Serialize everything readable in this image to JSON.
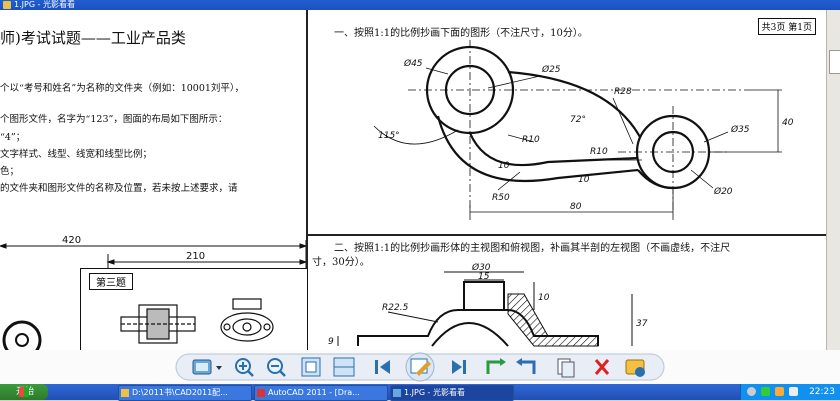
{
  "window": {
    "title": "1.JPG - 光影看看"
  },
  "document": {
    "left": {
      "title": "师)考试试题——工业产品类",
      "lines": [
        "个以“考号和姓名”为名称的文件夹（例如：10001刘平），",
        "个图形文件，名字为“123”，图面的布局如下图所示：",
        "“4”；",
        "文字样式、线型、线宽和线型比例；",
        "色；",
        "的文件夹和图形文件的名称及位置，若未按上述要求，请"
      ],
      "dim_420": "420",
      "dim_210": "210",
      "box_label": "第三题"
    },
    "page_box": "共3页  第1页",
    "q1": "一、按照1:1的比例抄画下面的图形（不注尺寸，10分）。",
    "q2_line1": "二、按照1:1的比例抄画形体的主视图和俯视图，补画其半剖的左视图（不画虚线，不注尺",
    "q2_line2": "寸，30分）。",
    "drawing1_labels": {
      "d45": "Ø45",
      "d25": "Ø25",
      "r28": "R28",
      "a115": "115°",
      "a72": "72°",
      "r10a": "R10",
      "r10b": "R10",
      "d35": "Ø35",
      "d20": "Ø20",
      "r50": "R50",
      "n10a": "10",
      "n10b": "10",
      "n40": "40",
      "n80": "80"
    },
    "drawing2_labels": {
      "d30": "Ø30",
      "n15": "15",
      "r225": "R22.5",
      "n10": "10",
      "n37": "37",
      "n9": "9"
    }
  },
  "toolbar": {
    "buttons": [
      "open-image",
      "dropdown",
      "zoom-in",
      "zoom-out",
      "fit-window",
      "actual-size",
      "first-image",
      "edit-image",
      "next-image",
      "rotate-left",
      "rotate-right",
      "copy",
      "delete",
      "settings"
    ]
  },
  "taskbar": {
    "start_label": "开始",
    "tasks": [
      "D:\\2011书\\CAD2011配...",
      "AutoCAD 2011 - [Dra...",
      "1.JPG - 光影看看"
    ],
    "clock": "22:23"
  },
  "colors": {
    "titlebar": "#1f5fd1",
    "taskbar": "#245edb",
    "tray": "#1090ef"
  }
}
